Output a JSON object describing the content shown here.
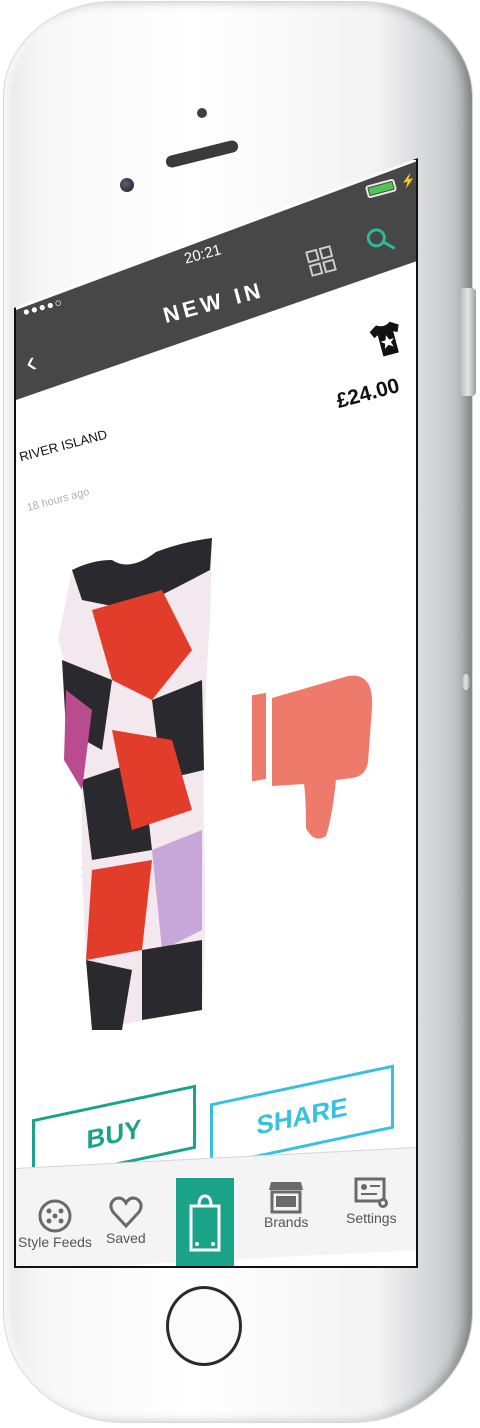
{
  "status": {
    "signal": "●●●●○",
    "time": "20:21"
  },
  "header": {
    "title": "NEW IN"
  },
  "product": {
    "brand": "RIVER ISLAND",
    "price": "£24.00",
    "posted": "18 hours ago"
  },
  "actions": {
    "buy_label": "BUY",
    "share_label": "SHARE"
  },
  "tabs": [
    {
      "label": "Style Feeds",
      "icon": "style-feeds-icon"
    },
    {
      "label": "Saved",
      "icon": "heart-icon"
    },
    {
      "label": "",
      "icon": "shopping-bag-icon"
    },
    {
      "label": "Brands",
      "icon": "storefront-icon"
    },
    {
      "label": "Settings",
      "icon": "settings-card-icon"
    }
  ],
  "colors": {
    "header_bg": "#474747",
    "buy": "#1aa389",
    "share": "#36c2dd",
    "dislike": "#ee7a6c",
    "battery": "#4fc64f"
  }
}
